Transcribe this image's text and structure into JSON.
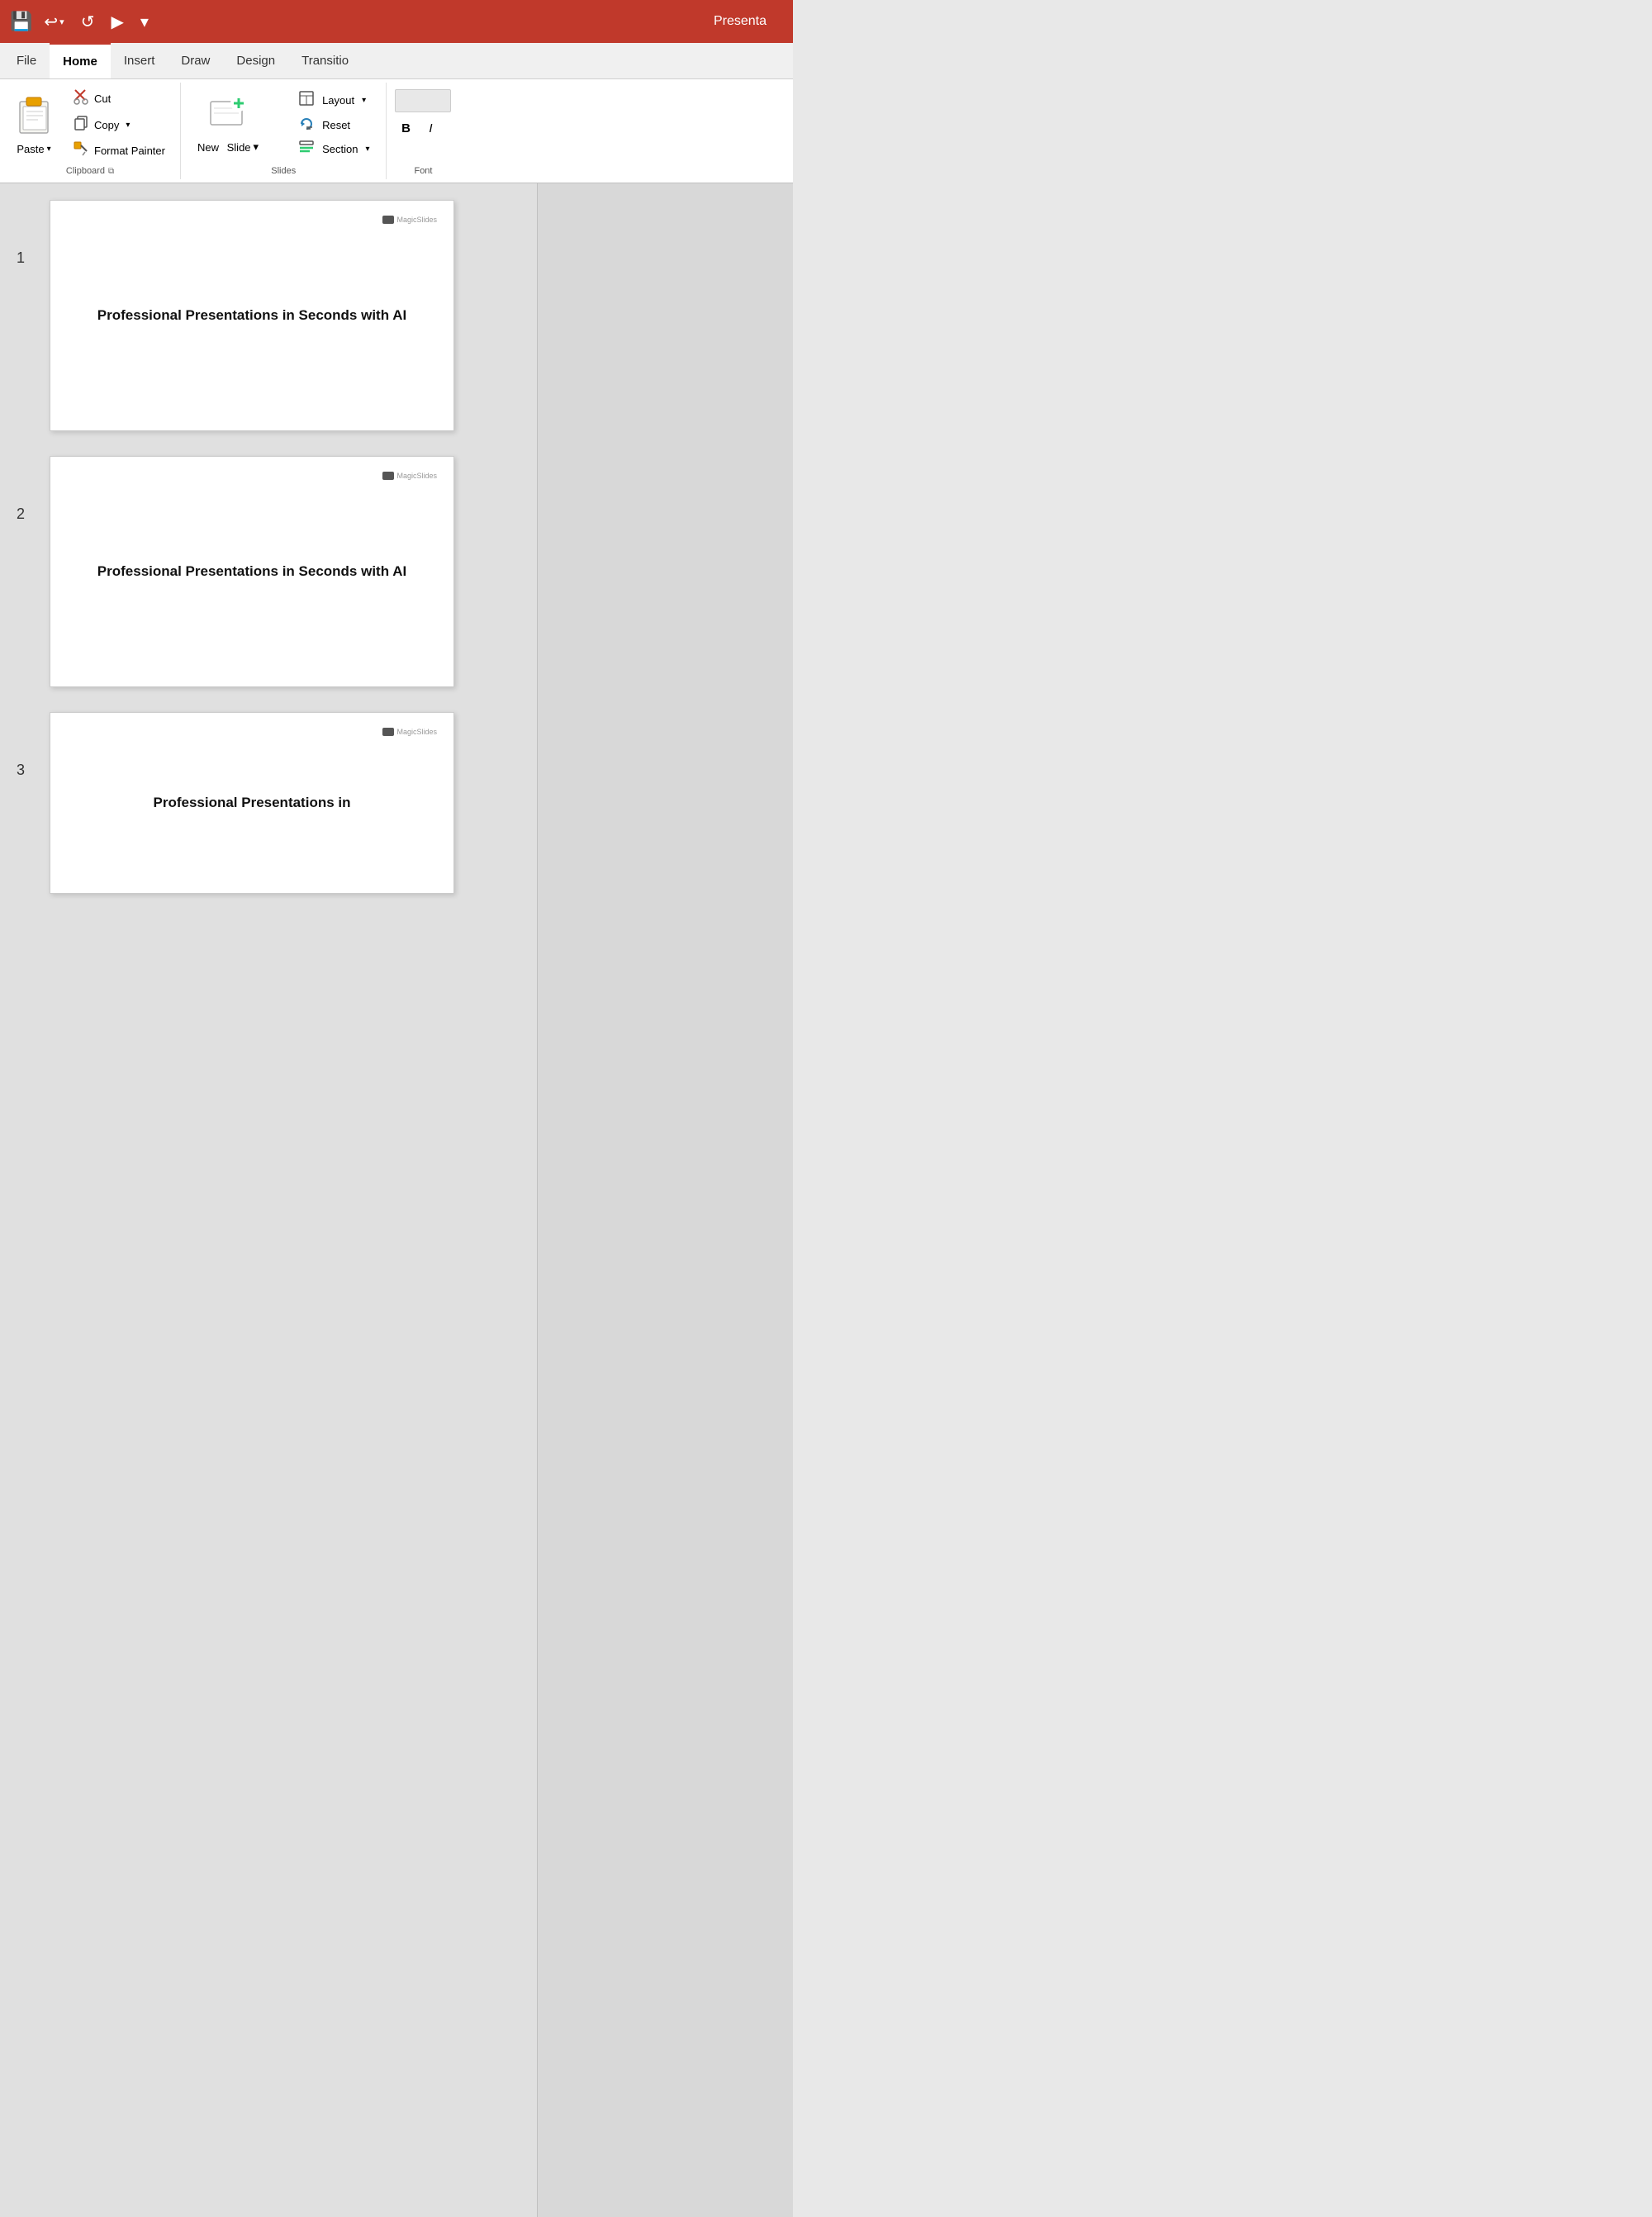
{
  "titleBar": {
    "saveIcon": "💾",
    "undoIcon": "↩",
    "undoArrow": "▾",
    "redoIcon": "↺",
    "presentIcon": "▶",
    "moreIcon": "▾",
    "title": "Presenta"
  },
  "tabs": [
    {
      "label": "File",
      "active": false
    },
    {
      "label": "Home",
      "active": true
    },
    {
      "label": "Insert",
      "active": false
    },
    {
      "label": "Draw",
      "active": false
    },
    {
      "label": "Design",
      "active": false
    },
    {
      "label": "Transitio",
      "active": false
    }
  ],
  "ribbon": {
    "clipboard": {
      "label": "Clipboard",
      "paste": {
        "label": "Paste",
        "arrow": "▾"
      },
      "cut": {
        "icon": "✂",
        "label": "Cut"
      },
      "copy": {
        "icon": "📋",
        "label": "Copy",
        "arrow": "▾"
      },
      "formatPainter": {
        "icon": "🖌",
        "label": "Format Painter"
      }
    },
    "slides": {
      "label": "Slides",
      "newSlide": {
        "label": "New",
        "label2": "Slide",
        "arrow": "▾"
      },
      "layout": {
        "icon": "⊞",
        "label": "Layout",
        "arrow": "▾"
      },
      "reset": {
        "icon": "↩",
        "label": "Reset"
      },
      "section": {
        "icon": "▤",
        "label": "Section",
        "arrow": "▾"
      }
    },
    "font": {
      "label": "Font",
      "boldLabel": "B",
      "italicLabel": "I"
    }
  },
  "slides": [
    {
      "number": "1",
      "logo": "MagicSlides",
      "title": "Professional Presentations in Seconds with AI"
    },
    {
      "number": "2",
      "logo": "MagicSlides",
      "title": "Professional Presentations in Seconds with AI"
    },
    {
      "number": "3",
      "logo": "MagicSlides",
      "title": "Professional Presentations in"
    }
  ]
}
